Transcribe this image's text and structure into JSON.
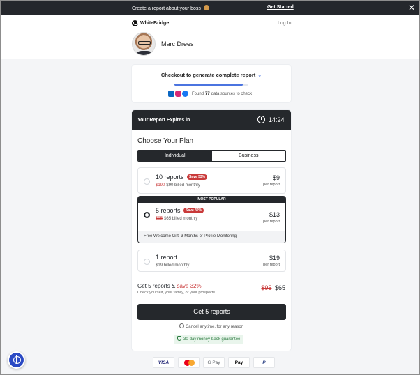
{
  "promo": {
    "text": "Create a report about your",
    "text_boss": "boss",
    "link": "Get Started",
    "close": "✕"
  },
  "header": {
    "brand": "WhiteBridge",
    "login": "Log In",
    "person_name": "Marc Drees"
  },
  "checkout": {
    "title": "Checkout to generate complete report",
    "chevron": "⌄",
    "progress_fraction": 0.92,
    "sources_prefix": "Found",
    "sources_count": "77",
    "sources_suffix": "data sources to check"
  },
  "plan": {
    "expire_label": "Your Report Expires in",
    "timer": "14:24",
    "choose_title": "Choose Your Plan",
    "tabs": [
      {
        "label": "Individual",
        "active": true
      },
      {
        "label": "Business",
        "active": false
      }
    ],
    "options": [
      {
        "name": "10 reports",
        "badge": "Save 53%",
        "old_price": "$190",
        "billed": "$90 billed monthly",
        "price": "$9",
        "per": "per report",
        "selected": false
      },
      {
        "name": "5 reports",
        "badge": "Save 32%",
        "old_price": "$95",
        "billed": "$65 billed monthly",
        "price": "$13",
        "per": "per report",
        "selected": true,
        "top_label": "MOST POPULAR",
        "gift": "Free Welcome Gift: 3 Months of Profile Monitoring"
      },
      {
        "name": "1 report",
        "billed": "$19 billed monthly",
        "price": "$19",
        "per": "per report",
        "selected": false
      }
    ],
    "summary": {
      "title": "Get 5 reports &",
      "save": "save 32%",
      "sub": "Check yourself, your family, or your prospects",
      "old_price": "$95",
      "price": "$65"
    },
    "cta": "Get 5 reports",
    "cancel": "Cancel anytime, for any reason",
    "guarantee": "30-day money-back guarantee"
  },
  "payments": {
    "visa": "VISA",
    "gpay": "G Pay",
    "applepay": " Pay",
    "paypal": "P"
  },
  "colors": {
    "dark": "#25282c",
    "accent_blue": "#4b74e0",
    "sale_red": "#c93a3a",
    "guarantee_green": "#2a7a3e"
  }
}
